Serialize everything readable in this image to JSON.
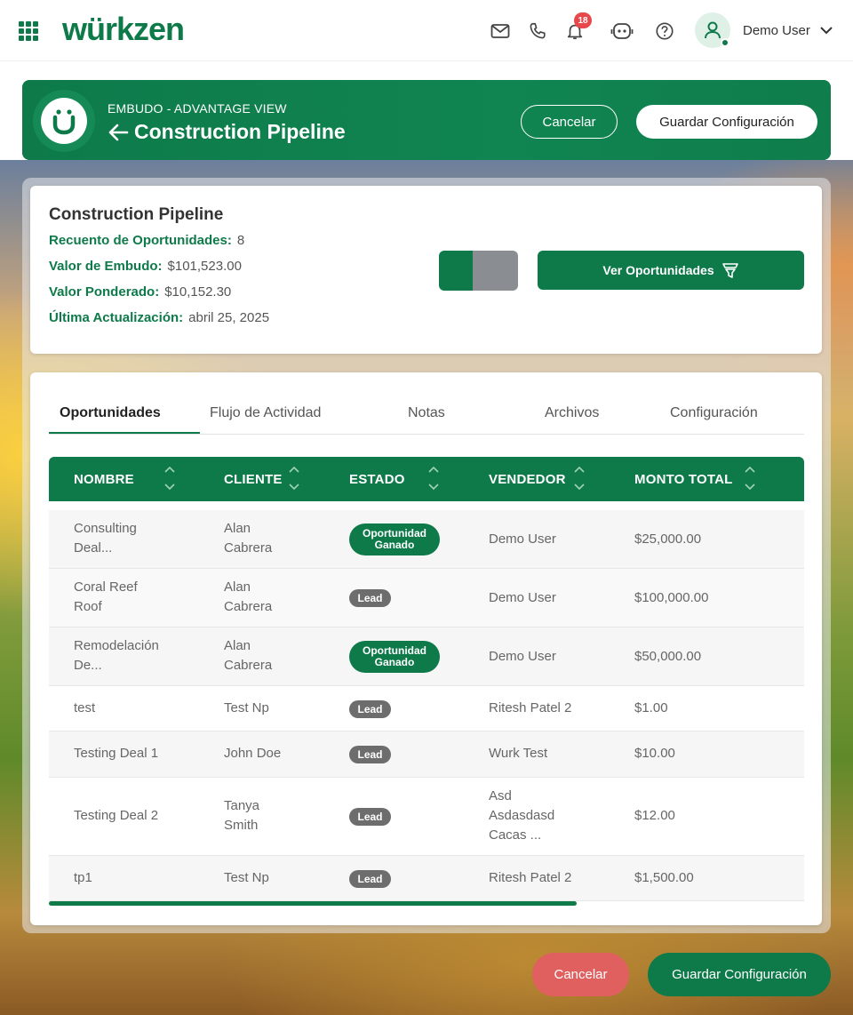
{
  "app": {
    "logo_text": "würkzen"
  },
  "topbar": {
    "notification_count": "18",
    "user_name": "Demo User",
    "icons": [
      "apps-grid-icon",
      "mail-icon",
      "phone-icon",
      "bell-icon",
      "robot-icon",
      "help-icon",
      "user-icon",
      "chevron-down-icon"
    ]
  },
  "header": {
    "breadcrumb": "EMBUDO - ADVANTAGE VIEW",
    "title": "Construction Pipeline",
    "cancel_label": "Cancelar",
    "save_label": "Guardar Configuración"
  },
  "summary": {
    "title": "Construction Pipeline",
    "stats": [
      {
        "label": "Recuento de Oportunidades:",
        "value": "8"
      },
      {
        "label": "Valor de Embudo:",
        "value": "$101,523.00"
      },
      {
        "label": "Valor Ponderado:",
        "value": "$10,152.30"
      },
      {
        "label": "Última Actualización:",
        "value": "abril 25, 2025"
      }
    ],
    "view_button_label": "Ver Oportunidades"
  },
  "tabs": [
    "Oportunidades",
    "Flujo de Actividad",
    "Notas",
    "Archivos",
    "Configuración"
  ],
  "table": {
    "columns": [
      "NOMBRE",
      "CLIENTE",
      "ESTADO",
      "VENDEDOR",
      "MONTO TOTAL"
    ],
    "rows": [
      {
        "nombre": [
          "Consulting",
          "Deal..."
        ],
        "cliente": [
          "Alan",
          "Cabrera"
        ],
        "estado": "Oportunidad Ganado",
        "estado_l1": "Oportunidad",
        "estado_l2": "Ganado",
        "vendedor": [
          "Demo User"
        ],
        "monto": "$25,000.00"
      },
      {
        "nombre": [
          "Coral Reef",
          "Roof"
        ],
        "cliente": [
          "Alan",
          "Cabrera"
        ],
        "estado": "Lead",
        "vendedor": [
          "Demo User"
        ],
        "monto": "$100,000.00"
      },
      {
        "nombre": [
          "Remodelación",
          "De..."
        ],
        "cliente": [
          "Alan",
          "Cabrera"
        ],
        "estado": "Oportunidad Ganado",
        "estado_l1": "Oportunidad",
        "estado_l2": "Ganado",
        "vendedor": [
          "Demo User"
        ],
        "monto": "$50,000.00"
      },
      {
        "nombre": [
          "test"
        ],
        "cliente": [
          "Test Np"
        ],
        "estado": "Lead",
        "vendedor": [
          "Ritesh Patel 2"
        ],
        "monto": "$1.00"
      },
      {
        "nombre": [
          "Testing Deal 1"
        ],
        "cliente": [
          "John Doe"
        ],
        "estado": "Lead",
        "vendedor": [
          "Wurk Test"
        ],
        "monto": "$10.00"
      },
      {
        "nombre": [
          "Testing Deal 2"
        ],
        "cliente": [
          "Tanya",
          "Smith"
        ],
        "estado": "Lead",
        "vendedor": [
          "Asd",
          "Asdasdasd",
          "Cacas ..."
        ],
        "monto": "$12.00"
      },
      {
        "nombre": [
          "tp1"
        ],
        "cliente": [
          "Test Np"
        ],
        "estado": "Lead",
        "vendedor": [
          "Ritesh Patel 2"
        ],
        "monto": "$1,500.00"
      }
    ]
  },
  "footer": {
    "cancel_label": "Cancelar",
    "save_label": "Guardar Configuración"
  },
  "colors": {
    "brand_green": "#0e7a4a",
    "cancel_red": "#e06060",
    "badge_red": "#e8484c"
  }
}
